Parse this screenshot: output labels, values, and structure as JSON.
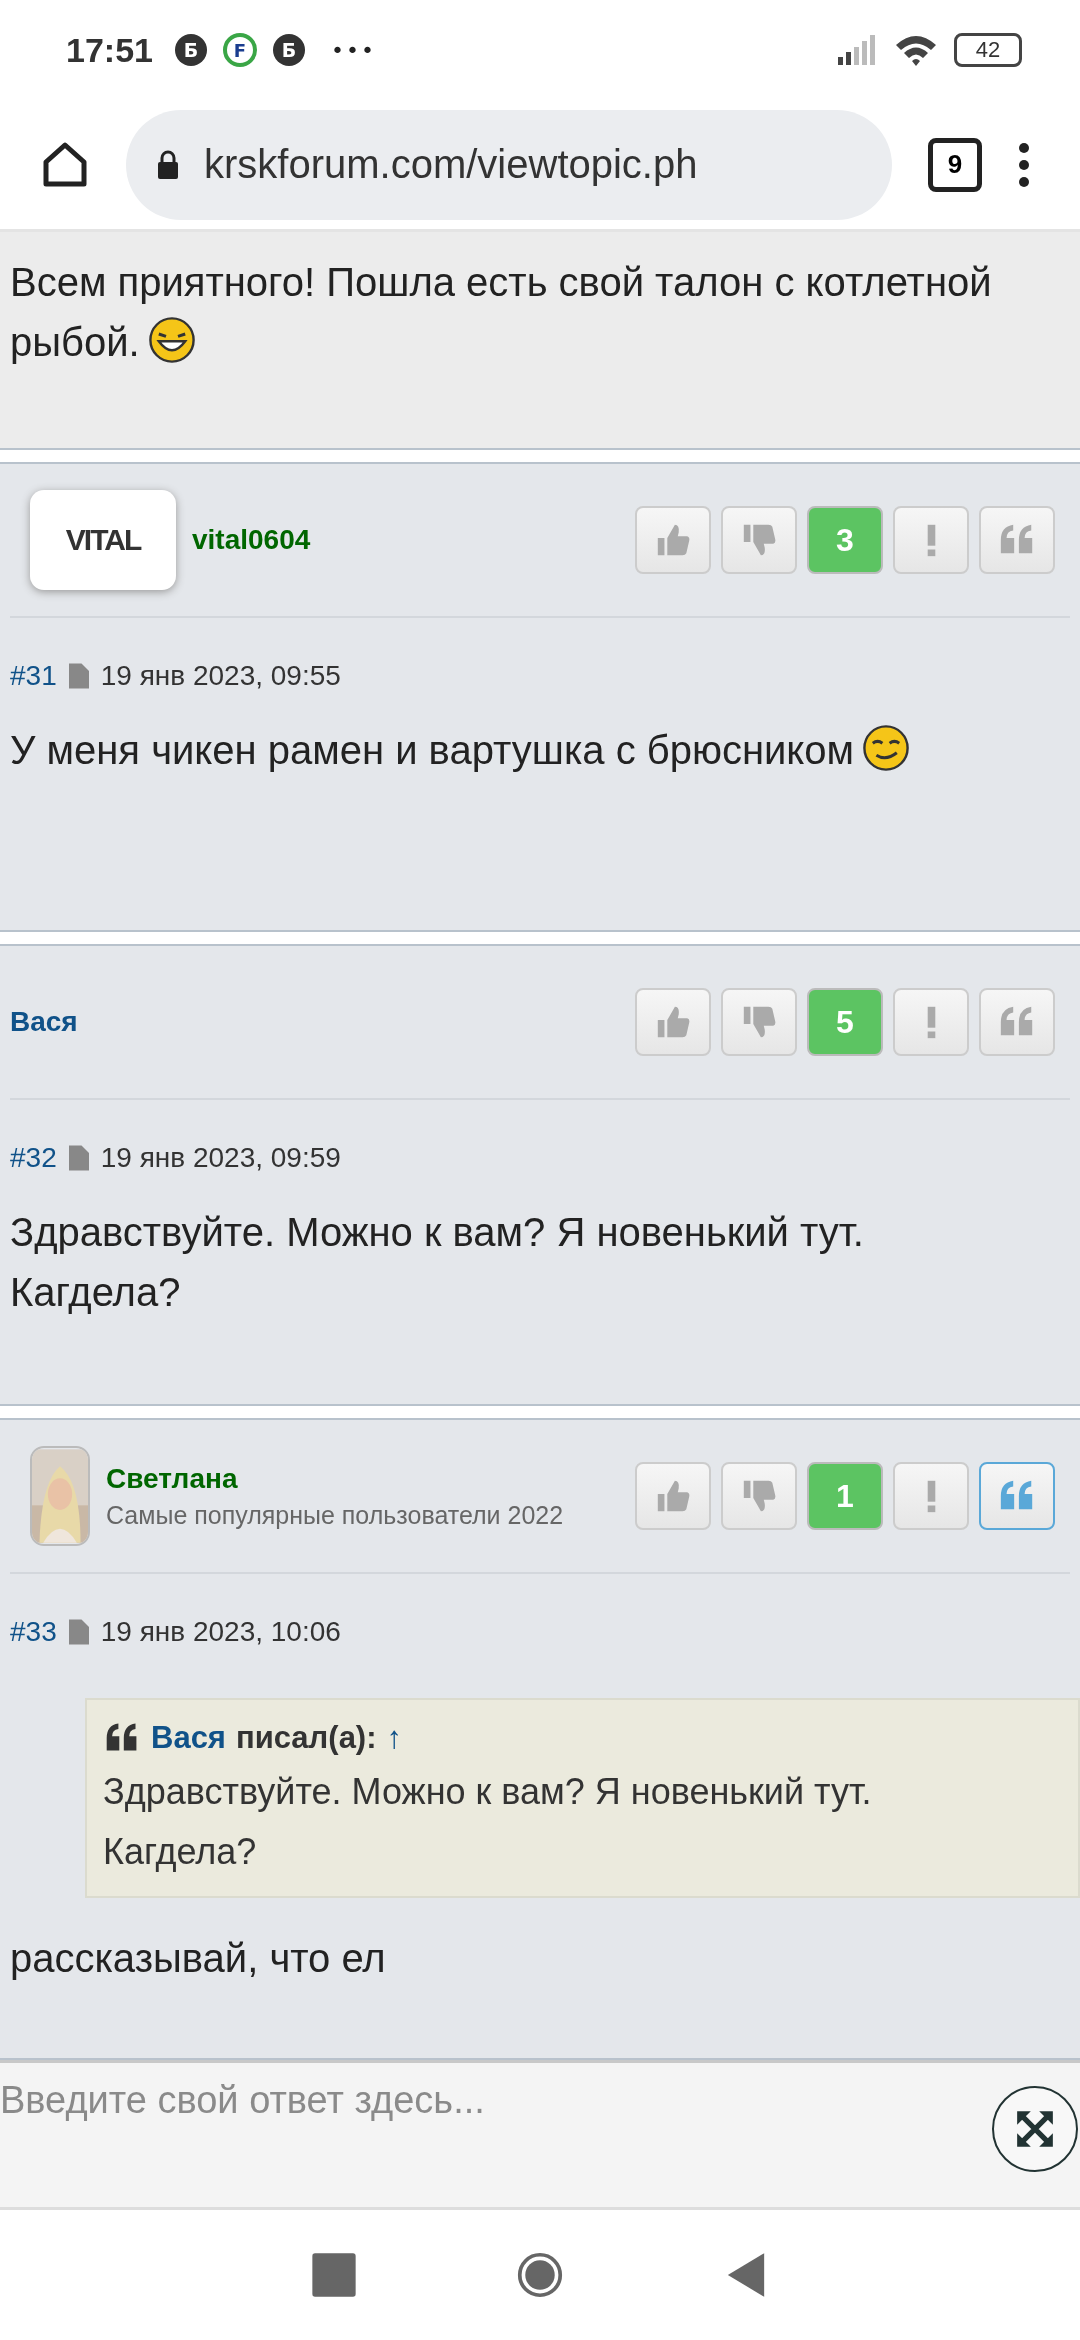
{
  "status_bar": {
    "time": "17:51",
    "notifications": [
      "Б",
      "F",
      "Б"
    ],
    "more": "•••",
    "battery": "42"
  },
  "browser": {
    "url": "krskforum.com/viewtopic.ph",
    "tab_count": "9"
  },
  "posts": [
    {
      "kind": "tail",
      "text": "Всем приятного! Пошла есть свой талон с котлетной рыбой.",
      "emoji": {
        "kind": "grin"
      }
    },
    {
      "kind": "post",
      "avatar": {
        "kind": "logo",
        "text": "VITAL"
      },
      "author": "vital0604",
      "color": "#006600",
      "score": "3",
      "quote_highlighted": false,
      "number": "#31",
      "date": "19 янв 2023, 09:55",
      "text": "У меня чикен рамен и вартушка с брюсником",
      "emoji": {
        "kind": "smirk"
      }
    },
    {
      "kind": "post",
      "author": "Вася",
      "color": "#105289",
      "score": "5",
      "quote_highlighted": false,
      "number": "#32",
      "date": "19 янв 2023, 09:59",
      "text": "Здравствуйте. Можно к вам? Я новенький тут. Кагдела?"
    },
    {
      "kind": "post",
      "author": "Светлана",
      "color": "#006600",
      "rank": "Самые популярные пользователи 2022",
      "score": "1",
      "quote_highlighted": true,
      "number": "#33",
      "date": "19 янв 2023, 10:06",
      "quote": {
        "author": "Вася",
        "wrote": "писал(а):",
        "link": "↑",
        "text": "Здравствуйте. Можно к вам? Я новенький тут. Кагдела?"
      },
      "text": "рассказывай, что ел"
    }
  ],
  "reply": {
    "placeholder": "Введите свой ответ здесь..."
  }
}
